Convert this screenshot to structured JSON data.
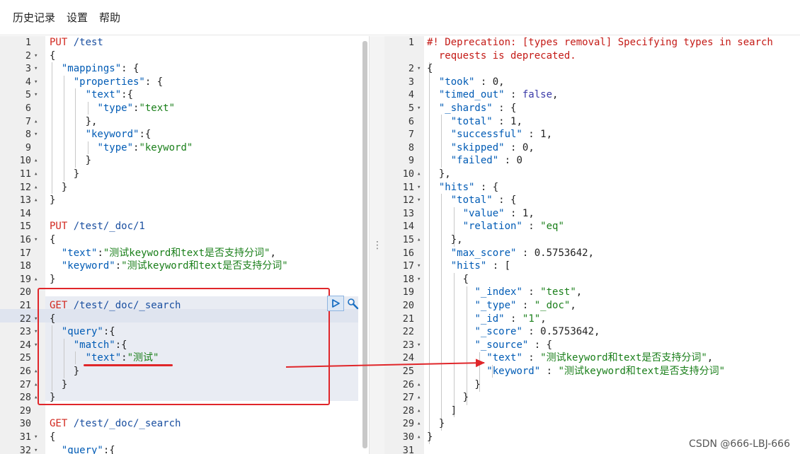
{
  "menu": {
    "items": [
      "历史记录",
      "设置",
      "帮助"
    ]
  },
  "editor": {
    "lines": [
      [
        [
          "PUT ",
          "m"
        ],
        [
          "/test",
          "u"
        ]
      ],
      [
        [
          "{",
          "p"
        ]
      ],
      [
        [
          "  ",
          "p"
        ],
        [
          "\"mappings\"",
          "k"
        ],
        [
          ": {",
          "p"
        ]
      ],
      [
        [
          "    ",
          "p"
        ],
        [
          "\"properties\"",
          "k"
        ],
        [
          ": {",
          "p"
        ]
      ],
      [
        [
          "      ",
          "p"
        ],
        [
          "\"text\"",
          "k"
        ],
        [
          ":{",
          "p"
        ]
      ],
      [
        [
          "        ",
          "p"
        ],
        [
          "\"type\"",
          "k"
        ],
        [
          ":",
          "p"
        ],
        [
          "\"text\"",
          "s"
        ]
      ],
      [
        [
          "      },",
          "p"
        ]
      ],
      [
        [
          "      ",
          "p"
        ],
        [
          "\"keyword\"",
          "k"
        ],
        [
          ":{",
          "p"
        ]
      ],
      [
        [
          "        ",
          "p"
        ],
        [
          "\"type\"",
          "k"
        ],
        [
          ":",
          "p"
        ],
        [
          "\"keyword\"",
          "s"
        ]
      ],
      [
        [
          "      }",
          "p"
        ]
      ],
      [
        [
          "    }",
          "p"
        ]
      ],
      [
        [
          "  }",
          "p"
        ]
      ],
      [
        [
          "}",
          "p"
        ]
      ],
      [],
      [
        [
          "PUT ",
          "m"
        ],
        [
          "/test/_doc/1",
          "u"
        ]
      ],
      [
        [
          "{",
          "p"
        ]
      ],
      [
        [
          "  ",
          "p"
        ],
        [
          "\"text\"",
          "k"
        ],
        [
          ":",
          "p"
        ],
        [
          "\"测试keyword和text是否支持分词\"",
          "s"
        ],
        [
          ",",
          "p"
        ]
      ],
      [
        [
          "  ",
          "p"
        ],
        [
          "\"keyword\"",
          "k"
        ],
        [
          ":",
          "p"
        ],
        [
          "\"测试keyword和text是否支持分词\"",
          "s"
        ]
      ],
      [
        [
          "}",
          "p"
        ]
      ],
      [],
      [
        [
          "GET ",
          "m"
        ],
        [
          "/test/_doc/_search",
          "u"
        ]
      ],
      [
        [
          "{",
          "p"
        ]
      ],
      [
        [
          "  ",
          "p"
        ],
        [
          "\"query\"",
          "k"
        ],
        [
          ":{",
          "p"
        ]
      ],
      [
        [
          "    ",
          "p"
        ],
        [
          "\"match\"",
          "k"
        ],
        [
          ":{",
          "p"
        ]
      ],
      [
        [
          "      ",
          "p"
        ],
        [
          "\"text\"",
          "k"
        ],
        [
          ":",
          "p"
        ],
        [
          "\"测试\"",
          "s"
        ]
      ],
      [
        [
          "    }",
          "p"
        ]
      ],
      [
        [
          "  }",
          "p"
        ]
      ],
      [
        [
          "}",
          "p"
        ]
      ],
      [],
      [
        [
          "GET ",
          "m"
        ],
        [
          "/test/_doc/_search",
          "u"
        ]
      ],
      [
        [
          "{",
          "p"
        ]
      ],
      [
        [
          "  ",
          "p"
        ],
        [
          "\"query\"",
          "k"
        ],
        [
          ":{",
          "p"
        ]
      ]
    ],
    "folds": [
      "",
      "▾",
      "▾",
      "▾",
      "▾",
      "",
      "▴",
      "▾",
      "",
      "▴",
      "▴",
      "▴",
      "▴",
      "",
      "",
      "▾",
      "",
      "",
      "▴",
      "",
      "",
      "▾",
      "▾",
      "▾",
      "",
      "▴",
      "▴",
      "▴",
      "",
      "",
      "▾",
      "▾"
    ]
  },
  "response": {
    "lines": [
      [
        [
          "#! Deprecation: [types removal] Specifying types in search",
          "cm"
        ]
      ],
      [
        [
          "  requests is deprecated.",
          "cm"
        ]
      ],
      [
        [
          "{",
          "p"
        ]
      ],
      [
        [
          "  ",
          "p"
        ],
        [
          "\"took\"",
          "k"
        ],
        [
          " : ",
          "p"
        ],
        [
          "0",
          "n"
        ],
        [
          ",",
          "p"
        ]
      ],
      [
        [
          "  ",
          "p"
        ],
        [
          "\"timed_out\"",
          "k"
        ],
        [
          " : ",
          "p"
        ],
        [
          "false",
          "bo"
        ],
        [
          ",",
          "p"
        ]
      ],
      [
        [
          "  ",
          "p"
        ],
        [
          "\"_shards\"",
          "k"
        ],
        [
          " : {",
          "p"
        ]
      ],
      [
        [
          "    ",
          "p"
        ],
        [
          "\"total\"",
          "k"
        ],
        [
          " : ",
          "p"
        ],
        [
          "1",
          "n"
        ],
        [
          ",",
          "p"
        ]
      ],
      [
        [
          "    ",
          "p"
        ],
        [
          "\"successful\"",
          "k"
        ],
        [
          " : ",
          "p"
        ],
        [
          "1",
          "n"
        ],
        [
          ",",
          "p"
        ]
      ],
      [
        [
          "    ",
          "p"
        ],
        [
          "\"skipped\"",
          "k"
        ],
        [
          " : ",
          "p"
        ],
        [
          "0",
          "n"
        ],
        [
          ",",
          "p"
        ]
      ],
      [
        [
          "    ",
          "p"
        ],
        [
          "\"failed\"",
          "k"
        ],
        [
          " : ",
          "p"
        ],
        [
          "0",
          "n"
        ]
      ],
      [
        [
          "  },",
          "p"
        ]
      ],
      [
        [
          "  ",
          "p"
        ],
        [
          "\"hits\"",
          "k"
        ],
        [
          " : {",
          "p"
        ]
      ],
      [
        [
          "    ",
          "p"
        ],
        [
          "\"total\"",
          "k"
        ],
        [
          " : {",
          "p"
        ]
      ],
      [
        [
          "      ",
          "p"
        ],
        [
          "\"value\"",
          "k"
        ],
        [
          " : ",
          "p"
        ],
        [
          "1",
          "n"
        ],
        [
          ",",
          "p"
        ]
      ],
      [
        [
          "      ",
          "p"
        ],
        [
          "\"relation\"",
          "k"
        ],
        [
          " : ",
          "p"
        ],
        [
          "\"eq\"",
          "s"
        ]
      ],
      [
        [
          "    },",
          "p"
        ]
      ],
      [
        [
          "    ",
          "p"
        ],
        [
          "\"max_score\"",
          "k"
        ],
        [
          " : ",
          "p"
        ],
        [
          "0.5753642",
          "n"
        ],
        [
          ",",
          "p"
        ]
      ],
      [
        [
          "    ",
          "p"
        ],
        [
          "\"hits\"",
          "k"
        ],
        [
          " : [",
          "p"
        ]
      ],
      [
        [
          "      {",
          "p"
        ]
      ],
      [
        [
          "        ",
          "p"
        ],
        [
          "\"_index\"",
          "k"
        ],
        [
          " : ",
          "p"
        ],
        [
          "\"test\"",
          "s"
        ],
        [
          ",",
          "p"
        ]
      ],
      [
        [
          "        ",
          "p"
        ],
        [
          "\"_type\"",
          "k"
        ],
        [
          " : ",
          "p"
        ],
        [
          "\"_doc\"",
          "s"
        ],
        [
          ",",
          "p"
        ]
      ],
      [
        [
          "        ",
          "p"
        ],
        [
          "\"_id\"",
          "k"
        ],
        [
          " : ",
          "p"
        ],
        [
          "\"1\"",
          "s"
        ],
        [
          ",",
          "p"
        ]
      ],
      [
        [
          "        ",
          "p"
        ],
        [
          "\"_score\"",
          "k"
        ],
        [
          " : ",
          "p"
        ],
        [
          "0.5753642",
          "n"
        ],
        [
          ",",
          "p"
        ]
      ],
      [
        [
          "        ",
          "p"
        ],
        [
          "\"_source\"",
          "k"
        ],
        [
          " : {",
          "p"
        ]
      ],
      [
        [
          "          ",
          "p"
        ],
        [
          "\"text\"",
          "k"
        ],
        [
          " : ",
          "p"
        ],
        [
          "\"测试keyword和text是否支持分词\"",
          "s"
        ],
        [
          ",",
          "p"
        ]
      ],
      [
        [
          "          ",
          "p"
        ],
        [
          "\"keyword\"",
          "k"
        ],
        [
          " : ",
          "p"
        ],
        [
          "\"测试keyword和text是否支持分词\"",
          "s"
        ]
      ],
      [
        [
          "        }",
          "p"
        ]
      ],
      [
        [
          "      }",
          "p"
        ]
      ],
      [
        [
          "    ]",
          "p"
        ]
      ],
      [
        [
          "  }",
          "p"
        ]
      ],
      [
        [
          "}",
          "p"
        ]
      ],
      []
    ],
    "numbers": [
      "1",
      "",
      "2",
      "3",
      "4",
      "5",
      "6",
      "7",
      "8",
      "9",
      "10",
      "11",
      "12",
      "13",
      "14",
      "15",
      "16",
      "17",
      "18",
      "19",
      "20",
      "21",
      "22",
      "23",
      "24",
      "25",
      "26",
      "27",
      "28",
      "29",
      "30",
      "31"
    ],
    "folds": [
      "",
      "",
      "▾",
      "",
      "",
      "▾",
      "",
      "",
      "",
      "",
      "▴",
      "▾",
      "▾",
      "",
      "",
      "▴",
      "",
      "▾",
      "▾",
      "",
      "",
      "",
      "",
      "▾",
      "",
      "",
      "▴",
      "▴",
      "▴",
      "▴",
      "▴",
      ""
    ]
  },
  "colors": {
    "m": "#d1281f",
    "u": "#1a4fa0",
    "k": "#005bb5",
    "s": "#1a7f1a",
    "n": "#222222",
    "bo": "#3a3aa8",
    "p": "#222222",
    "cm": "#c41a16",
    "annotation": "#e0262a"
  },
  "watermark": "CSDN @666-LBJ-666"
}
